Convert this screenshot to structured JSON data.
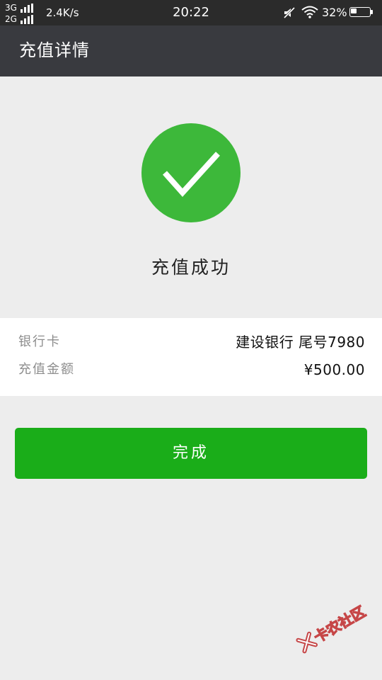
{
  "status_bar": {
    "network_top": "3G",
    "network_bottom": "2G",
    "net_speed": "2.4K/s",
    "time": "20:22",
    "battery_percent": "32%",
    "battery_level": 0.32
  },
  "header": {
    "title": "充值详情"
  },
  "result": {
    "icon": "check-circle-icon",
    "text": "充值成功",
    "accent_color": "#3db83a"
  },
  "details": {
    "bank_card_label": "银行卡",
    "bank_card_value": "建设银行 尾号7980",
    "amount_label": "充值金额",
    "amount_value": "¥500.00"
  },
  "actions": {
    "done_label": "完成",
    "button_color": "#1aad19"
  },
  "watermark": {
    "text": "卡农社区"
  }
}
